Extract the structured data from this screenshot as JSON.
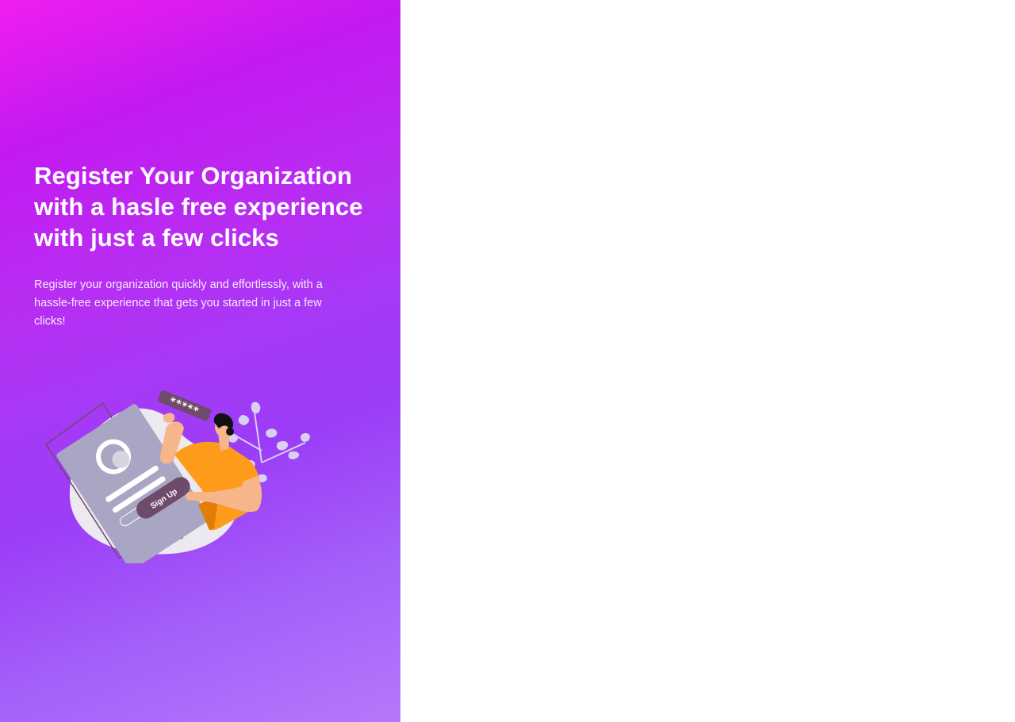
{
  "hero": {
    "title": "Register Your Organization with a hasle free experience with just a few clicks",
    "subtitle": "Register your organization quickly and effortlessly, with a hassle-free experience that gets you started in just a few clicks!",
    "illustration": {
      "password_stars": "*****",
      "sign_up_button_label": "Sign Up"
    }
  },
  "colors": {
    "gradient_top": "#f01ef0",
    "gradient_mid": "#9b3cf7",
    "gradient_bottom": "#b678fb",
    "text": "#ffffff"
  }
}
